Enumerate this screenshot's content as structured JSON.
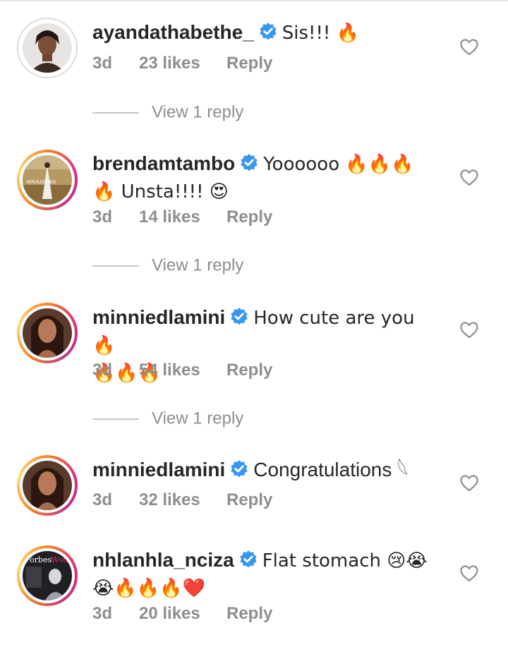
{
  "comments": [
    {
      "username": "ayandathabethe_",
      "text": "Sis!!! 🔥",
      "time": "3d",
      "likes": "23 likes",
      "reply": "Reply",
      "view_replies": "View 1 reply"
    },
    {
      "username": "brendamtambo",
      "text": "Yoooooo 🔥🔥🔥",
      "text2": "🔥 Unsta!!!! 😍",
      "time": "3d",
      "likes": "14 likes",
      "reply": "Reply",
      "view_replies": "View 1 reply"
    },
    {
      "username": "minniedlamini",
      "text": "How cute are you 🔥",
      "text2": "🔥🔥🔥",
      "time": "3d",
      "likes": "54 likes",
      "reply": "Reply",
      "view_replies": "View 1 reply"
    },
    {
      "username": "minniedlamini",
      "text": "Congratulations 𓆩",
      "time": "3d",
      "likes": "32 likes",
      "reply": "Reply"
    },
    {
      "username": "nhlanhla_nciza",
      "text": "Flat stomach 😢😭",
      "text2": "😭🔥🔥🔥❤️",
      "time": "3d",
      "likes": "20 likes",
      "reply": "Reply"
    }
  ],
  "icons": {
    "verified": "verified-badge-icon",
    "like": "heart-icon"
  },
  "colors": {
    "verified_blue": "#3897f0",
    "muted_text": "#8e8e8e",
    "primary_text": "#262626"
  }
}
